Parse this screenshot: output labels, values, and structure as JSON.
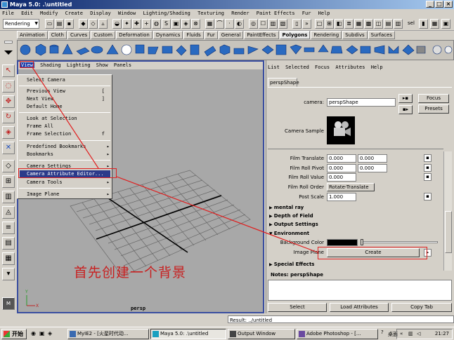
{
  "window": {
    "title": "Maya 5.0: .\\untitled"
  },
  "menubar": [
    "File",
    "Edit",
    "Modify",
    "Create",
    "Display",
    "Window",
    "Lighting/Shading",
    "Texturing",
    "Render",
    "Paint Effects",
    "Fur",
    "Help"
  ],
  "status": {
    "mode": "Rendering",
    "sel_label": "sel"
  },
  "shelf_tabs": [
    "Animation",
    "Cloth",
    "Curves",
    "Custom",
    "Deformation",
    "Dynamics",
    "Fluids",
    "Fur",
    "General",
    "PaintEffects",
    "Polygons",
    "Rendering",
    "Subdivs",
    "Surfaces"
  ],
  "active_shelf": "Polygons",
  "viewport": {
    "menu": [
      "View",
      "Shading",
      "Lighting",
      "Show",
      "Panels"
    ],
    "camera_label": "persp"
  },
  "view_menu": {
    "items": [
      {
        "label": "Select Camera",
        "shortcut": ""
      },
      {
        "label": "Previous View",
        "shortcut": "["
      },
      {
        "label": "Next View",
        "shortcut": "]"
      },
      {
        "label": "Default Home",
        "shortcut": ""
      },
      {
        "label": "Look at Selection",
        "shortcut": ""
      },
      {
        "label": "Frame All",
        "shortcut": ""
      },
      {
        "label": "Frame Selection",
        "shortcut": "f"
      },
      {
        "label": "Predefined Bookmarks",
        "shortcut": "▸"
      },
      {
        "label": "Bookmarks",
        "shortcut": "▸"
      },
      {
        "label": "Camera Settings",
        "shortcut": "▸"
      },
      {
        "label": "Camera Attribute Editor...",
        "shortcut": ""
      },
      {
        "label": "Camera Tools",
        "shortcut": "▸"
      },
      {
        "label": "Image Plane",
        "shortcut": "▸"
      }
    ]
  },
  "annotation": "首先创建一个背景",
  "attribute_editor": {
    "menu": [
      "List",
      "Selected",
      "Focus",
      "Attributes",
      "Help"
    ],
    "tab": "perspShape",
    "camera_label": "camera:",
    "camera_value": "perspShape",
    "focus_btn": "Focus",
    "presets_btn": "Presets",
    "sample_label": "Camera Sample",
    "fields": [
      {
        "label": "Film Translate",
        "v1": "0.000",
        "v2": "0.000"
      },
      {
        "label": "Film Roll Pivot",
        "v1": "0.000",
        "v2": "0.000"
      },
      {
        "label": "Film Roll Value",
        "v1": "0.000",
        "v2": ""
      }
    ],
    "roll_order_label": "Film Roll Order",
    "roll_order_value": "Rotate-Translate",
    "post_scale_label": "Post Scale",
    "post_scale_value": "1.000",
    "sections": [
      "mental ray",
      "Depth of Field",
      "Output Settings",
      "Environment",
      "Special Effects"
    ],
    "bg_color_label": "Background Color",
    "image_plane_label": "Image Plane",
    "create_btn": "Create",
    "notes_label": "Notes: perspShape",
    "bottom_buttons": [
      "Select",
      "Load Attributes",
      "Copy Tab"
    ]
  },
  "helpline": {
    "result": "Result: ../untitled"
  },
  "taskbar": {
    "start": "开始",
    "tasks": [
      "MyIE2 - [火星时代动...",
      "Maya 5.0: .\\untitled",
      "Output Window",
      "Adobe Photoshop - [..."
    ],
    "tray_label": "桌面",
    "clock": "21:27"
  },
  "colors": {
    "accent": "#0a246a",
    "annotation": "#c82020",
    "menu_highlight": "#2c3a8a"
  }
}
